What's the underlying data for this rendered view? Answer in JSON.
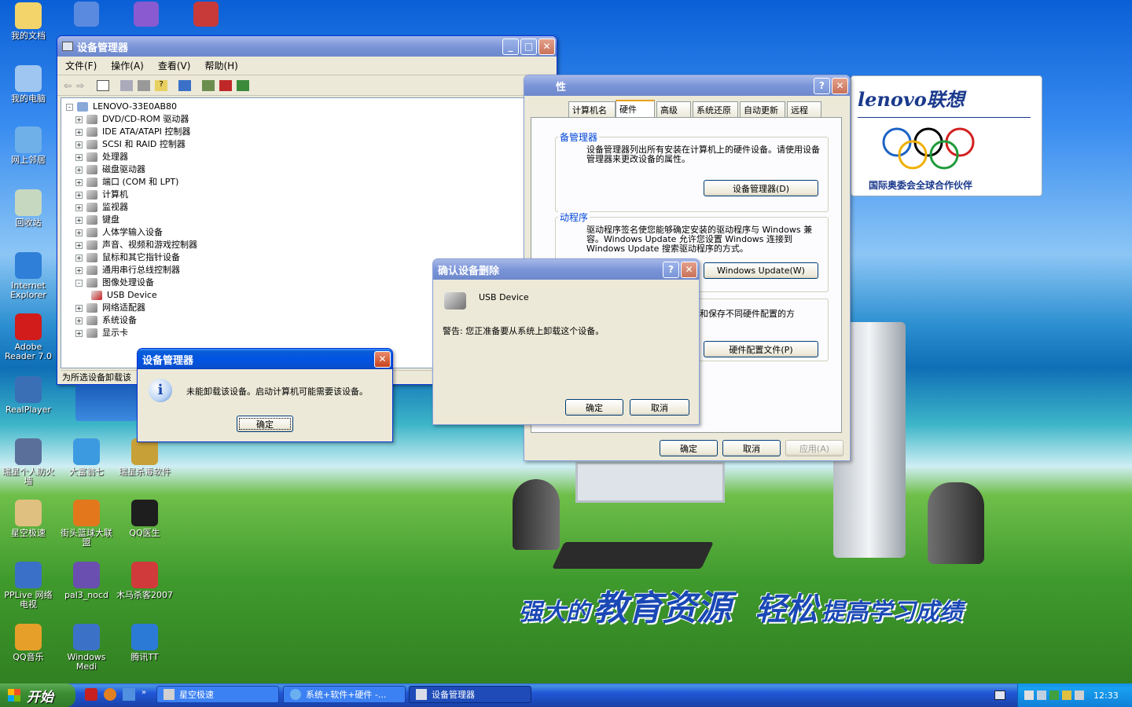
{
  "desktop": {
    "icons": [
      {
        "label": "我的文档",
        "color": "#f3d46b"
      },
      {
        "label": "我的电脑",
        "color": "#9fc6f0"
      },
      {
        "label": "网上邻居",
        "color": "#6fb0e8"
      },
      {
        "label": "回收站",
        "color": "#c6d9c0"
      },
      {
        "label": "Internet Explorer",
        "color": "#2f7fd8"
      },
      {
        "label": "Adobe Reader 7.0",
        "color": "#d21b1b"
      },
      {
        "label": "RealPlayer",
        "color": "#3b6fb5"
      },
      {
        "label": "瑞星个人防火墙",
        "color": "#5a6f9a"
      },
      {
        "label": "大富翁七",
        "color": "#3c9be0"
      },
      {
        "label": "瑞星杀毒软件",
        "color": "#c7a038"
      },
      {
        "label": "星空极速",
        "color": "#e0c080"
      },
      {
        "label": "街头篮球大联盟",
        "color": "#e2771c"
      },
      {
        "label": "QQ医生",
        "color": "#1e1e1e"
      },
      {
        "label": "PPLive 网络电视",
        "color": "#3a70c8"
      },
      {
        "label": "pal3_nocd",
        "color": "#6a4fb0"
      },
      {
        "label": "木马杀客2007",
        "color": "#d03a3a"
      },
      {
        "label": "QQ音乐",
        "color": "#e6a02a"
      },
      {
        "label": "Windows Medi",
        "color": "#3b72c8"
      },
      {
        "label": "腾讯TT",
        "color": "#2b7ad6"
      }
    ],
    "ad": {
      "brand": "lenovo联想",
      "olympic_text": "国际奥委会全球合作伙伴",
      "slogan1": "强大的",
      "slogan2": "教育资源",
      "slogan3": "轻松",
      "slogan4": "提高学习成绩"
    }
  },
  "device_manager": {
    "title": "设备管理器",
    "menu": [
      "文件(F)",
      "操作(A)",
      "查看(V)",
      "帮助(H)"
    ],
    "root": "LENOVO-33E0AB80",
    "tree": [
      {
        "label": "DVD/CD-ROM 驱动器",
        "sign": "+"
      },
      {
        "label": "IDE ATA/ATAPI 控制器",
        "sign": "+"
      },
      {
        "label": "SCSI 和 RAID 控制器",
        "sign": "+"
      },
      {
        "label": "处理器",
        "sign": "+"
      },
      {
        "label": "磁盘驱动器",
        "sign": "+"
      },
      {
        "label": "端口 (COM 和 LPT)",
        "sign": "+"
      },
      {
        "label": "计算机",
        "sign": "+"
      },
      {
        "label": "监视器",
        "sign": "+"
      },
      {
        "label": "键盘",
        "sign": "+"
      },
      {
        "label": "人体学输入设备",
        "sign": "+"
      },
      {
        "label": "声音、视频和游戏控制器",
        "sign": "+"
      },
      {
        "label": "鼠标和其它指针设备",
        "sign": "+"
      },
      {
        "label": "通用串行总线控制器",
        "sign": "+"
      },
      {
        "label": "图像处理设备",
        "sign": "-"
      },
      {
        "label": "USB Device",
        "sign": ""
      },
      {
        "label": "网络适配器",
        "sign": "+"
      },
      {
        "label": "系统设备",
        "sign": "+"
      },
      {
        "label": "显示卡",
        "sign": "+"
      }
    ],
    "status": "为所选设备卸载该"
  },
  "props": {
    "title": "性",
    "tabs": [
      "计算机名",
      "硬件",
      "高级",
      "系统还原",
      "自动更新",
      "远程"
    ],
    "section1_title": "备管理器",
    "section1_text": "设备管理器列出所有安装在计算机上的硬件设备。请使用设备管理器来更改设备的属性。",
    "section1_button": "设备管理器(D)",
    "section2_title": "动程序",
    "section2_text": "驱动程序签名使您能够确定安装的驱动程序与 Windows 兼容。Windows Update 允许您设置 Windows 连接到 Windows Update 搜索驱动程序的方式。",
    "section2_button": "Windows Update(W)",
    "section3_text": "和保存不同硬件配置的方",
    "section3_button": "硬件配置文件(P)",
    "ok": "确定",
    "cancel": "取消",
    "apply": "应用(A)"
  },
  "confirm": {
    "title": "确认设备删除",
    "device": "USB Device",
    "warning": "警告: 您正准备要从系统上卸载这个设备。",
    "ok": "确定",
    "cancel": "取消"
  },
  "msg": {
    "title": "设备管理器",
    "text": "未能卸载该设备。启动计算机可能需要该设备。",
    "ok": "确定"
  },
  "taskbar": {
    "start": "开始",
    "tasks": [
      "星空极速",
      "系统+软件+硬件 -...",
      "设备管理器"
    ],
    "clock": "12:33"
  }
}
